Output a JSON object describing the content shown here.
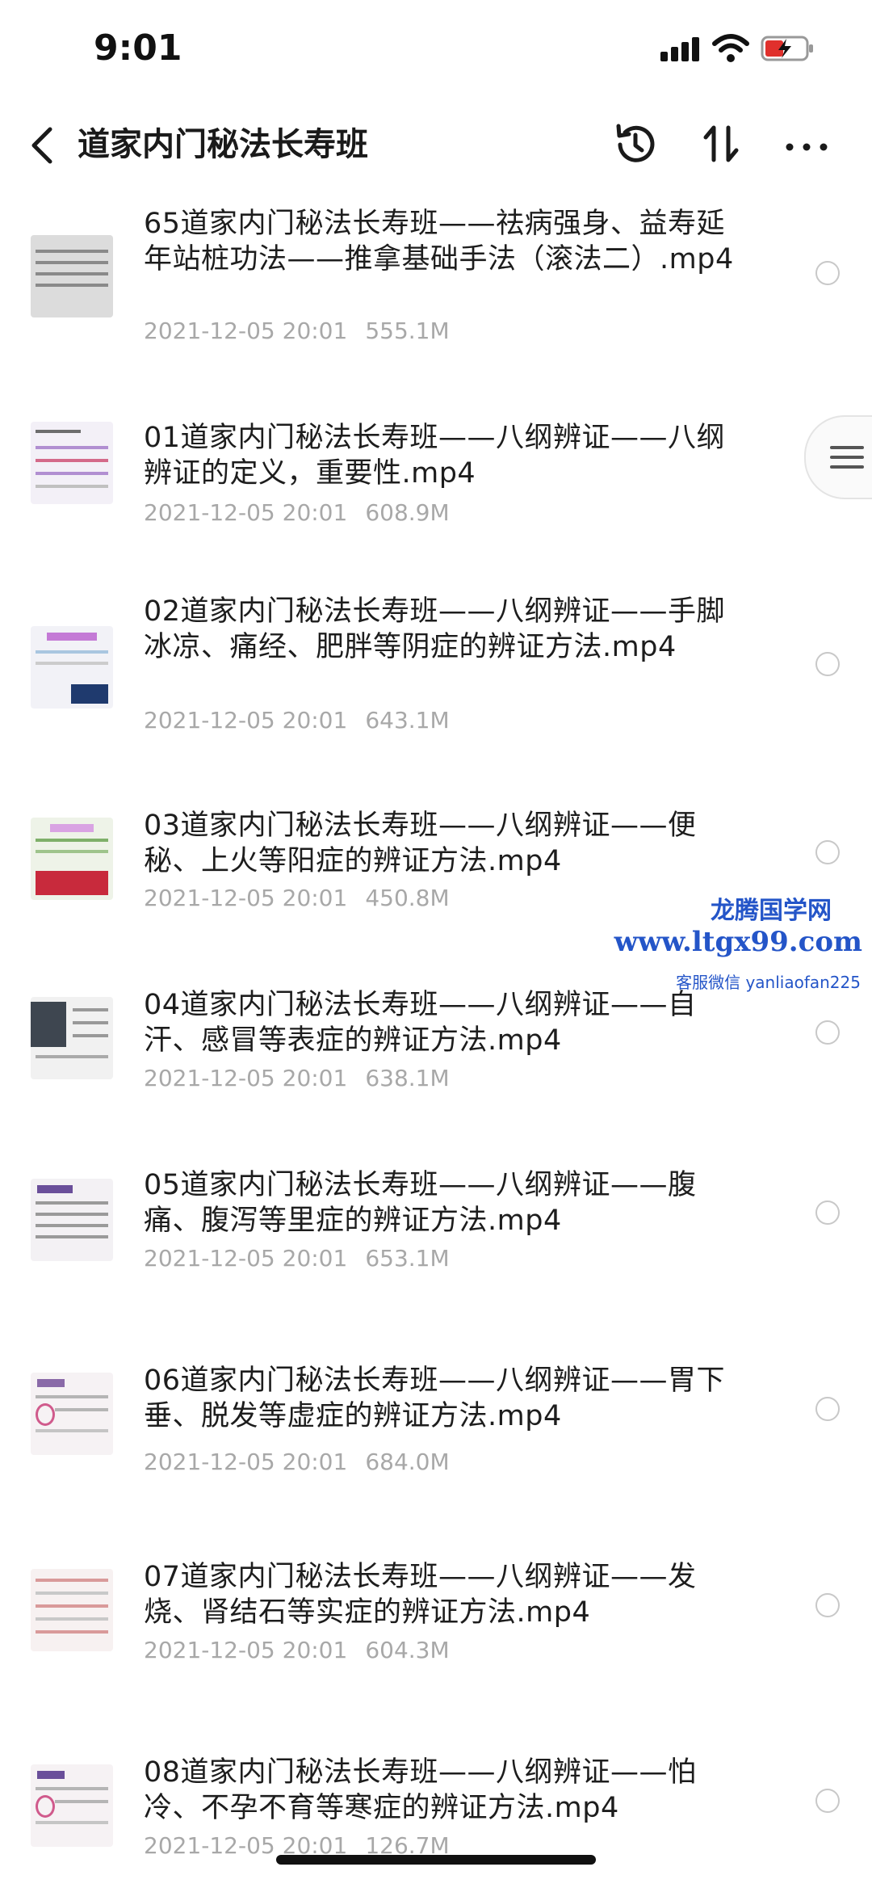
{
  "status_bar": {
    "time": "9:01"
  },
  "header": {
    "title": "道家内门秘法长寿班"
  },
  "watermark": {
    "line1": "龙腾国学网",
    "line2": "www.ltgx99.com",
    "line3": "客服微信 yanliaofan225"
  },
  "items": [
    {
      "name": "65道家内门秘法长寿班——祛病强身、益寿延年站桩功法——推拿基础手法（滚法二）.mp4",
      "date": "2021-12-05 20:01",
      "size": "555.1M"
    },
    {
      "name": "01道家内门秘法长寿班——八纲辨证——八纲辨证的定义，重要性.mp4",
      "date": "2021-12-05 20:01",
      "size": "608.9M"
    },
    {
      "name": "02道家内门秘法长寿班——八纲辨证——手脚冰凉、痛经、肥胖等阴症的辨证方法.mp4",
      "date": "2021-12-05 20:01",
      "size": "643.1M"
    },
    {
      "name": "03道家内门秘法长寿班——八纲辨证——便秘、上火等阳症的辨证方法.mp4",
      "date": "2021-12-05 20:01",
      "size": "450.8M"
    },
    {
      "name": "04道家内门秘法长寿班——八纲辨证——自汗、感冒等表症的辨证方法.mp4",
      "date": "2021-12-05 20:01",
      "size": "638.1M"
    },
    {
      "name": "05道家内门秘法长寿班——八纲辨证——腹痛、腹泻等里症的辨证方法.mp4",
      "date": "2021-12-05 20:01",
      "size": "653.1M"
    },
    {
      "name": "06道家内门秘法长寿班——八纲辨证——胃下垂、脱发等虚症的辨证方法.mp4",
      "date": "2021-12-05 20:01",
      "size": "684.0M"
    },
    {
      "name": "07道家内门秘法长寿班——八纲辨证——发烧、肾结石等实症的辨证方法.mp4",
      "date": "2021-12-05 20:01",
      "size": "604.3M"
    },
    {
      "name": "08道家内门秘法长寿班——八纲辨证——怕冷、不孕不育等寒症的辨证方法.mp4",
      "date": "2021-12-05 20:01",
      "size": "126.7M"
    }
  ]
}
